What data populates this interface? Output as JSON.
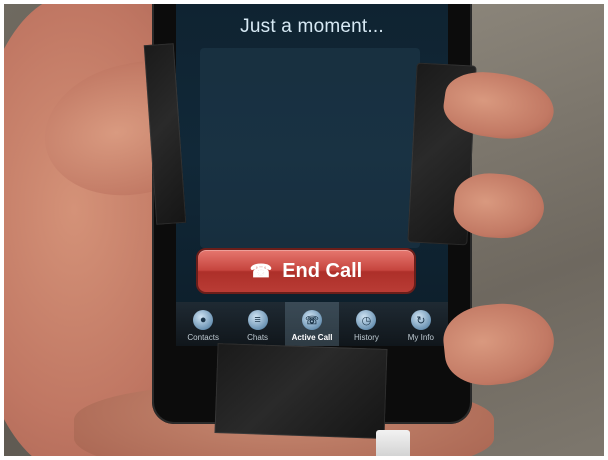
{
  "screen": {
    "status_text": "Just a moment...",
    "end_call_label": "End Call"
  },
  "tabs": [
    {
      "label": "Contacts",
      "icon": "person-icon"
    },
    {
      "label": "Chats",
      "icon": "chat-bubble-icon"
    },
    {
      "label": "Active Call",
      "icon": "phone-icon"
    },
    {
      "label": "History",
      "icon": "clock-icon"
    },
    {
      "label": "My Info",
      "icon": "refresh-icon"
    }
  ],
  "colors": {
    "end_call": "#c6453e",
    "screen_bg": "#112838"
  }
}
